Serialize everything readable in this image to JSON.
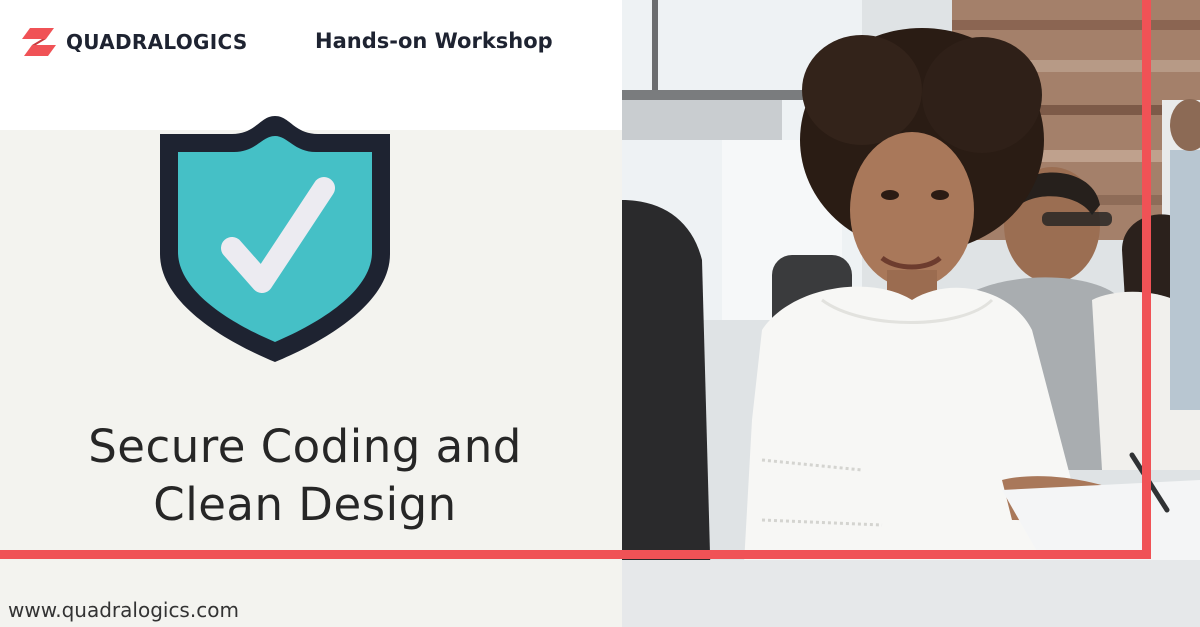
{
  "brand": {
    "name": "QUADRALOGICS",
    "logo_icon": "diagonal-bars-logo-icon",
    "accent_color": "#f05256",
    "dark_color": "#1e2331"
  },
  "header": {
    "tagline": "Hands-on Workshop"
  },
  "hero": {
    "icon": "shield-check-icon",
    "shield_fill": "#45c0c6",
    "title_line1": "Secure Coding and",
    "title_line2": "Clean Design"
  },
  "footer": {
    "website": "www.quadralogics.com"
  },
  "photo": {
    "description_icon": "people-at-workshop-photo"
  }
}
